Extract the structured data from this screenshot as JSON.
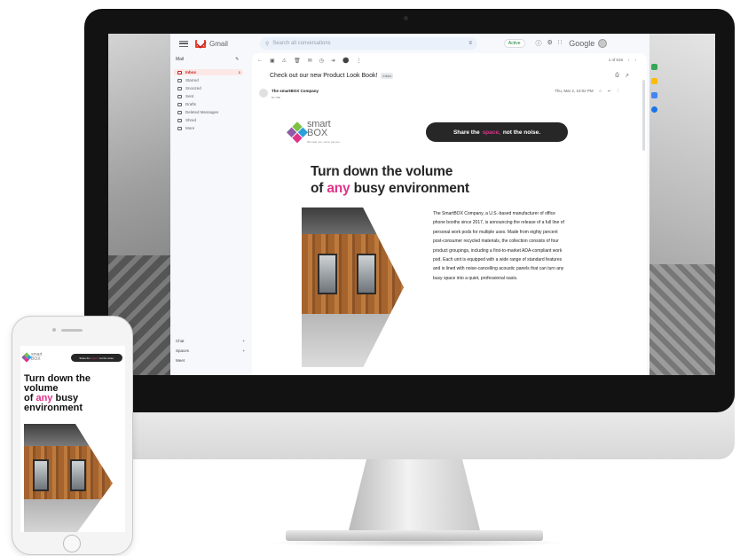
{
  "gmail": {
    "app_name": "Gmail",
    "search_placeholder": "Search all conversations",
    "status": "Active",
    "brand": "Google",
    "compose": "Mail",
    "nav": [
      {
        "label": "Inbox",
        "count": "1"
      },
      {
        "label": "Starred",
        "count": ""
      },
      {
        "label": "Snoozed",
        "count": ""
      },
      {
        "label": "Sent",
        "count": ""
      },
      {
        "label": "Drafts",
        "count": ""
      },
      {
        "label": "Deleted Messages",
        "count": ""
      },
      {
        "label": "Shred",
        "count": ""
      },
      {
        "label": "More",
        "count": ""
      }
    ],
    "sections": [
      "Chat",
      "Spaces",
      "Meet"
    ],
    "pager": "1 of 616",
    "subject": "Check out our new Product Look Book!",
    "inbox_tag": "Inbox",
    "sender": "The smartBOX Company",
    "sender_sub": "to me",
    "date": "Thu, Mar 2, 10:02 PM"
  },
  "email": {
    "logo_top": "smart",
    "logo_bottom": "BOX",
    "logo_tag": "We hear you, we've got you.",
    "pill_before": "Share the",
    "pill_highlight": "space,",
    "pill_after": "not the noise.",
    "headline_line1": "Turn down the volume",
    "headline_of": "of",
    "headline_accent": "any",
    "headline_rest": "busy environment",
    "body": "The SmartBOX Company, a U.S.-based manufacturer of office phone booths since 2017, is announcing the release of a full line of personal work pods for multiple uses. Made from eighty percent post-consumer recycled materials, the collection consists of four product groupings, including a first-to-market ADA-compliant work pod. Each unit is equipped with a wide range of standard features and is lined with noise-cancelling acoustic panels that can turn any busy space into a quiet, professional oasis."
  },
  "phone": {
    "logo_top": "smart",
    "logo_bottom": "BOX",
    "pill_before": "Share the",
    "pill_highlight": "space,",
    "pill_after": "not the noise.",
    "headline_line1": "Turn down the",
    "headline_line2": "volume",
    "headline_of": "of",
    "headline_accent": "any",
    "headline_rest": "busy",
    "headline_line4": "environment"
  },
  "colors": {
    "accent_pink": "#e0338a",
    "logo_green": "#7cc142",
    "logo_blue": "#2b9fd9",
    "logo_pink": "#e0338a",
    "logo_purple": "#8e5ba6",
    "gmail_red": "#ea4335"
  }
}
